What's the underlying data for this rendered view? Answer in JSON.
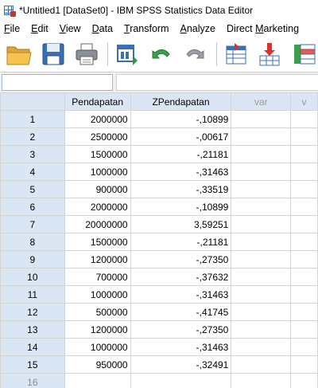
{
  "window": {
    "title": "*Untitled1 [DataSet0] - IBM SPSS Statistics Data Editor"
  },
  "menu": [
    {
      "label": "File",
      "u": "F",
      "rest": "ile"
    },
    {
      "label": "Edit",
      "u": "E",
      "rest": "dit"
    },
    {
      "label": "View",
      "u": "V",
      "rest": "iew"
    },
    {
      "label": "Data",
      "u": "D",
      "rest": "ata"
    },
    {
      "label": "Transform",
      "u": "T",
      "rest": "ransform"
    },
    {
      "label": "Analyze",
      "u": "A",
      "rest": "nalyze"
    },
    {
      "label": "Direct Marketing",
      "pre": "Direct ",
      "u": "M",
      "rest": "arketing"
    }
  ],
  "toolbar": {
    "icons": [
      "open-folder-icon",
      "save-icon",
      "print-icon",
      "recall-dialog-icon",
      "undo-icon",
      "redo-icon",
      "goto-case-icon",
      "goto-variable-icon",
      "variables-icon"
    ]
  },
  "grid": {
    "columns": [
      "Pendapatan",
      "ZPendapatan",
      "var",
      "v"
    ],
    "rows": [
      {
        "n": "1",
        "pendapatan": "2000000",
        "z": "-,10899"
      },
      {
        "n": "2",
        "pendapatan": "2500000",
        "z": "-,00617"
      },
      {
        "n": "3",
        "pendapatan": "1500000",
        "z": "-,21181"
      },
      {
        "n": "4",
        "pendapatan": "1000000",
        "z": "-,31463"
      },
      {
        "n": "5",
        "pendapatan": "900000",
        "z": "-,33519"
      },
      {
        "n": "6",
        "pendapatan": "2000000",
        "z": "-,10899"
      },
      {
        "n": "7",
        "pendapatan": "20000000",
        "z": "3,59251"
      },
      {
        "n": "8",
        "pendapatan": "1500000",
        "z": "-,21181"
      },
      {
        "n": "9",
        "pendapatan": "1200000",
        "z": "-,27350"
      },
      {
        "n": "10",
        "pendapatan": "700000",
        "z": "-,37632"
      },
      {
        "n": "11",
        "pendapatan": "1000000",
        "z": "-,31463"
      },
      {
        "n": "12",
        "pendapatan": "500000",
        "z": "-,41745"
      },
      {
        "n": "13",
        "pendapatan": "1200000",
        "z": "-,27350"
      },
      {
        "n": "14",
        "pendapatan": "1000000",
        "z": "-,31463"
      },
      {
        "n": "15",
        "pendapatan": "950000",
        "z": "-,32491"
      },
      {
        "n": "16",
        "pendapatan": "",
        "z": ""
      }
    ]
  },
  "colors": {
    "header_bg": "#dbe6f4",
    "grid_line": "#d4d4d4"
  }
}
